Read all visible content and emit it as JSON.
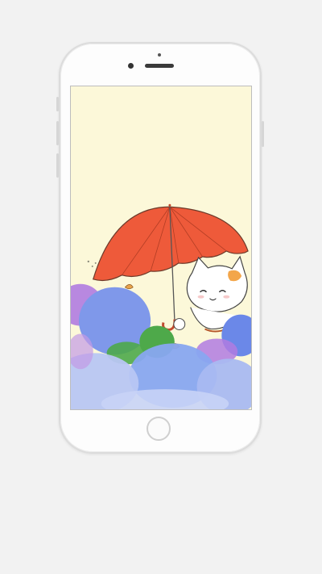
{
  "device": {
    "model": "smartphone",
    "screen_content": "wallpaper",
    "colors": {
      "background": "#f2f2f2",
      "body": "#fdfdfd",
      "screen_sky": "#fcf8d9",
      "umbrella": "#ee5a3a",
      "hydrangea_blue": "#7f98ea",
      "hydrangea_purple": "#b07be0",
      "leaf_green": "#4ea94a"
    }
  },
  "icons": {
    "camera": "camera-icon",
    "home": "home-button-icon"
  }
}
